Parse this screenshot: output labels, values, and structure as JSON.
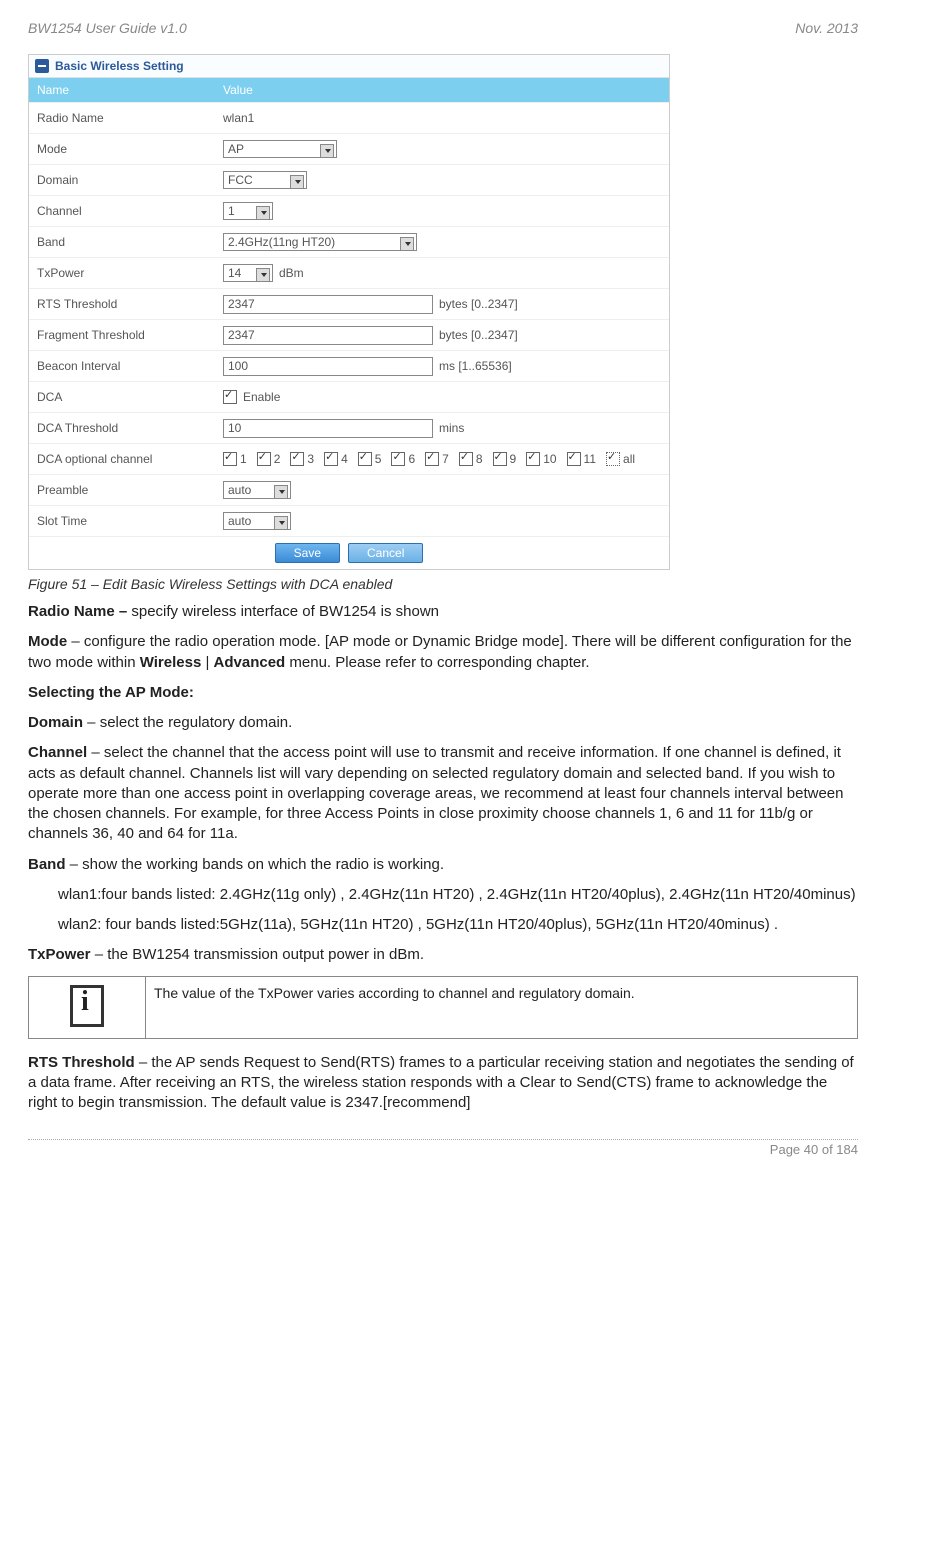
{
  "header": {
    "left": "BW1254 User Guide v1.0",
    "right": "Nov.  2013"
  },
  "panel": {
    "title": "Basic Wireless Setting",
    "col1": "Name",
    "col2": "Value",
    "rows": {
      "radioName": {
        "label": "Radio Name",
        "value": "wlan1"
      },
      "mode": {
        "label": "Mode",
        "value": "AP"
      },
      "domain": {
        "label": "Domain",
        "value": "FCC"
      },
      "channel": {
        "label": "Channel",
        "value": "1"
      },
      "band": {
        "label": "Band",
        "value": "2.4GHz(11ng HT20)"
      },
      "txpower": {
        "label": "TxPower",
        "value": "14",
        "unit": "dBm"
      },
      "rts": {
        "label": "RTS Threshold",
        "value": "2347",
        "hint": "bytes [0..2347]"
      },
      "frag": {
        "label": "Fragment Threshold",
        "value": "2347",
        "hint": "bytes [0..2347]"
      },
      "beacon": {
        "label": "Beacon Interval",
        "value": "100",
        "hint": "ms [1..65536]"
      },
      "dca": {
        "label": "DCA",
        "enable": "Enable"
      },
      "dcaThresh": {
        "label": "DCA Threshold",
        "value": "10",
        "hint": "mins"
      },
      "dcaOpt": {
        "label": "DCA optional channel",
        "options": [
          "1",
          "2",
          "3",
          "4",
          "5",
          "6",
          "7",
          "8",
          "9",
          "10",
          "11",
          "all"
        ]
      },
      "preamble": {
        "label": "Preamble",
        "value": "auto"
      },
      "slot": {
        "label": "Slot Time",
        "value": "auto"
      }
    },
    "buttons": {
      "save": "Save",
      "cancel": "Cancel"
    }
  },
  "caption": "Figure 51 – Edit Basic Wireless Settings with DCA enabled",
  "para": {
    "radioName_b": "Radio Name –",
    "radioName_t": " specify wireless interface of BW1254 is shown",
    "mode_b": "Mode",
    "mode_t1": " – configure the radio operation mode. [AP mode or Dynamic Bridge mode]. There will be different configuration for the two mode within ",
    "mode_w": "Wireless",
    "mode_sep": " | ",
    "mode_a": "Advanced",
    "mode_t2": " menu. Please refer to corresponding chapter.",
    "selectAP": "Selecting the AP Mode:",
    "domain_b": "Domain",
    "domain_t": " – select the regulatory domain.",
    "channel_b": "Channel",
    "channel_t": " – select the channel that the access point will use to transmit and receive information. If one channel is defined, it acts as default channel. Channels list will vary depending on selected regulatory domain and selected band. If you wish to operate more than one access point in overlapping coverage areas, we recommend at least four channels interval between the chosen channels. For example, for three Access Points in close proximity choose channels 1, 6 and 11 for 11b/g or channels 36, 40 and 64 for 11a.",
    "band_b": "Band",
    "band_t": " – show the working bands on which the radio is working.",
    "wlan1": "wlan1:four bands listed: 2.4GHz(11g only) , 2.4GHz(11n HT20) , 2.4GHz(11n HT20/40plus), 2.4GHz(11n HT20/40minus)",
    "wlan2": "wlan2: four bands listed:5GHz(11a), 5GHz(11n HT20) , 5GHz(11n HT20/40plus), 5GHz(11n HT20/40minus) .",
    "txp_b": "TxPower",
    "txp_t": "  – the BW1254 transmission output power in dBm.",
    "info": "The value of the TxPower varies according to channel and regulatory domain.",
    "rts_b": "RTS Threshold",
    "rts_t": " – the AP sends Request to Send(RTS) frames to a particular receiving station and negotiates the sending of a data frame. After receiving an RTS, the wireless station responds with a Clear to Send(CTS) frame to acknowledge the right to begin transmission. The default value is 2347.[recommend]"
  },
  "footer": "Page 40 of 184"
}
